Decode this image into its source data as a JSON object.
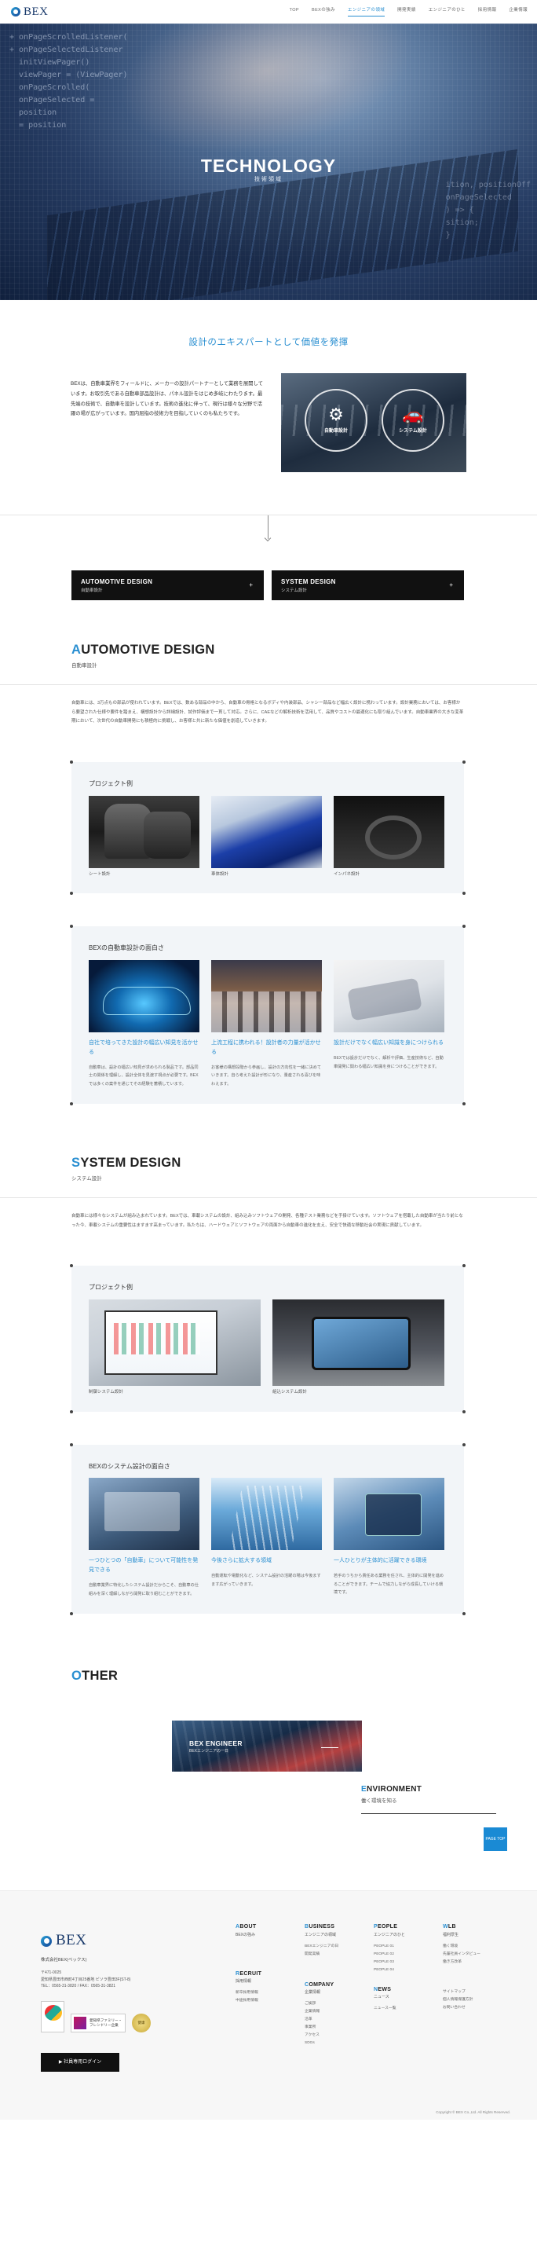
{
  "header": {
    "logo_text": "BEX",
    "nav": [
      "TOP",
      "BEXの強み",
      "エンジニアの領域",
      "開発実績",
      "エンジニアのひと",
      "採用情報",
      "企業情報"
    ],
    "active_index": 2
  },
  "hero": {
    "title": "TECHNOLOGY",
    "subtitle": "技術領域",
    "code_left": "+ onPageScrolledListener(\n+ onPageSelectedListener\n  initViewPager()\n  viewPager = (ViewPager)\n  onPageScrolled(\n  onPageSelected =\n  position\n  = position",
    "code_right": "  ition, positionOff\n  onPageSelected\n  ) => {\n  sition;\n  }"
  },
  "intro": {
    "heading": "設計のエキスパートとして価値を発揮",
    "text": "BEXは、自動車業界をフィールドに、メーカーの設計パートナーとして業務を展開しています。お取引先である自動車部品設計は、パネル設計をはじめ多岐にわたります。最先端の技術で、自動車を設計しています。技術の進化に伴って、現行は様々な分野で活躍の場が広がっています。国内屈指の技術力を目指していくのも私たちです。",
    "img_labels": [
      "自動車設計",
      "システム設計"
    ]
  },
  "tabs": [
    {
      "title": "AUTOMOTIVE DESIGN",
      "sub": "自動車設計",
      "icon": "+"
    },
    {
      "title": "SYSTEM DESIGN",
      "sub": "システム設計",
      "icon": "+"
    }
  ],
  "automotive": {
    "title_first": "A",
    "title_rest": "UTOMOTIVE DESIGN",
    "sub": "自動車設計",
    "body": "自動車には、3万点もの部品が使われています。BEXでは、数ある部品の中から、自動車の骨格となるボディや内装部品、シャシー部品など幅広く設計に携わっています。設計業務においては、お客様から要望された仕様や要件を踏まえ、構想設計から詳細設計、試作評価まで一貫して対応。さらに、CAEなどの解析技術を活用して、品質やコストの最適化にも取り組んでいます。自動車業界の大きな変革期において、次世代の自動車開発にも積極的に挑戦し、お客様と共に新たな価値を創造していきます。",
    "examples_title": "プロジェクト例",
    "examples": [
      "シート設計",
      "車体設計",
      "インパネ設計"
    ],
    "features_title": "BEXの自動車設計の面白さ",
    "features": [
      {
        "head": "自社で培ってきた設計の幅広い知見を活かせる",
        "text": "自動車は、設計の幅広い知見が求められる製品です。部品同士の関係を理解し、設計全体を見渡す視点が必要です。BEXでは多くの案件を通じてその経験を蓄積しています。"
      },
      {
        "head": "上流工程に携われる！設計者の力量が活かせる",
        "text": "お客様の構想段階から参画し、設計の方向性を一緒に決めていきます。自ら考えた設計が形になり、量産される喜びを味わえます。"
      },
      {
        "head": "設計だけでなく幅広い知識を身につけられる",
        "text": "BEXでは設計だけでなく、解析や評価、生産技術など、自動車開発に関わる幅広い知識を身につけることができます。"
      }
    ]
  },
  "system": {
    "title_first": "S",
    "title_rest": "YSTEM DESIGN",
    "sub": "システム設計",
    "body": "自動車には様々なシステムが組み込まれています。BEXでは、車載システムの設計、組み込みソフトウェアの開発、各種テスト業務などを手掛けています。ソフトウェアを搭載した自動車が当たり前となった今、車載システムの重要性はますます高まっています。私たちは、ハードウェアとソフトウェアの両面から自動車の進化を支え、安全で快適な移動社会の実現に貢献しています。",
    "examples_title": "プロジェクト例",
    "examples": [
      "制御システム設計",
      "組込システム設計"
    ],
    "features_title": "BEXのシステム設計の面白さ",
    "features": [
      {
        "head": "一つひとつの「自動車」について可能性を発見できる",
        "text": "自動車業界に特化したシステム設計だからこそ、自動車の仕組みを深く理解しながら開発に取り組むことができます。"
      },
      {
        "head": "今後さらに拡大する領域",
        "text": "自動運転や電動化など、システム設計の活躍の場は今後ますます広がっていきます。"
      },
      {
        "head": "一人ひとりが主体的に活躍できる環境",
        "text": "若手のうちから責任ある業務を任され、主体的に開発を進めることができます。チームで協力しながら成長していける環境です。"
      }
    ]
  },
  "other": {
    "title_first": "O",
    "title_rest": "THER",
    "banner_title": "BEX ENGINEER",
    "banner_sub": "BEXエンジニアの一日",
    "env_title_first": "E",
    "env_title_rest": "NVIRONMENT",
    "env_sub": "働く環境を知る",
    "pagetop": "PAGE TOP"
  },
  "footer": {
    "logo_text": "BEX",
    "company": "株式会社BEX(ベックス)",
    "address": "〒471-0025\n愛知県豊田市西町4丁目25番地 ビソラ豊田3F(ST-8)\nTEL：0565-31-3820 / FAX：0565-31-3821",
    "badge2": "愛知県ファミリー・フレンドリー企業",
    "badge3": "健康",
    "login": "▶ 社員専用ログイン",
    "cols": [
      {
        "first": "A",
        "rest": "BOUT",
        "ja": "BEXの強み",
        "items": []
      },
      {
        "first": "B",
        "rest": "USINESS",
        "ja": "エンジニアの領域",
        "items": [
          "BEXエンジニアの日",
          "開発実績"
        ]
      },
      {
        "first": "P",
        "rest": "EOPLE",
        "ja": "エンジニアのひと",
        "items": [
          "PEOPLE 01",
          "PEOPLE 02",
          "PEOPLE 03",
          "PEOPLE 04"
        ]
      },
      {
        "first": "W",
        "rest": "LB",
        "ja": "福利厚生",
        "items": [
          "働く環境",
          "先輩社員インタビュー",
          "働き方改革"
        ]
      }
    ],
    "cols2": [
      {
        "first": "R",
        "rest": "ECRUIT",
        "ja": "採用情報",
        "items": [
          "新卒採用情報",
          "中途採用情報"
        ]
      },
      {
        "first": "C",
        "rest": "OMPANY",
        "ja": "企業情報",
        "items": [
          "ご挨拶",
          "企業情報",
          "沿革",
          "事業所",
          "アクセス",
          "SDGs"
        ]
      },
      {
        "first": "N",
        "rest": "EWS",
        "ja": "ニュース",
        "items": [
          "ニュース一覧"
        ]
      },
      {
        "first": "",
        "rest": "",
        "ja": "",
        "items": [
          "サイトマップ",
          "個人情報保護方針",
          "お問い合わせ"
        ]
      }
    ],
    "copyright": "Copyright © BEX Co.,Ltd. All Rights Reserved."
  }
}
